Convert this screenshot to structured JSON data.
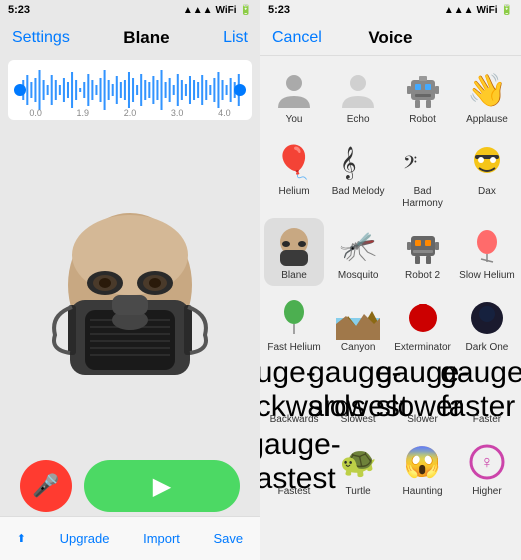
{
  "left": {
    "status": "5:23",
    "nav": {
      "back": "Settings",
      "title": "Blane",
      "right": "List"
    },
    "waveform": {
      "labels": [
        "0.0",
        "1.9",
        "2.0",
        "3.0",
        "4.0"
      ]
    },
    "controls": {
      "mic_aria": "Record",
      "play_aria": "Play"
    },
    "toolbar": {
      "share": "Share",
      "upgrade": "Upgrade",
      "import": "Import",
      "save": "Save"
    }
  },
  "right": {
    "status": "5:23",
    "nav": {
      "cancel": "Cancel",
      "title": "Voice"
    },
    "voices": [
      {
        "id": "you",
        "label": "You",
        "icon": "👤",
        "selected": false
      },
      {
        "id": "echo",
        "label": "Echo",
        "icon": "👤",
        "selected": false
      },
      {
        "id": "robot",
        "label": "Robot",
        "icon": "🤖",
        "selected": false
      },
      {
        "id": "applause",
        "label": "Applause",
        "icon": "👋",
        "selected": false
      },
      {
        "id": "helium",
        "label": "Helium",
        "icon": "🎈",
        "selected": false
      },
      {
        "id": "bad-melody",
        "label": "Bad Melody",
        "icon": "🎼",
        "selected": false
      },
      {
        "id": "bad-harmony",
        "label": "Bad Harmony",
        "icon": "🎼",
        "selected": false
      },
      {
        "id": "dax",
        "label": "Dax",
        "icon": "😎",
        "selected": false
      },
      {
        "id": "blane",
        "label": "Blane",
        "icon": "🎭",
        "selected": true
      },
      {
        "id": "mosquito",
        "label": "Mosquito",
        "icon": "🦟",
        "selected": false
      },
      {
        "id": "robot2",
        "label": "Robot 2",
        "icon": "🤖",
        "selected": false
      },
      {
        "id": "slow-helium",
        "label": "Slow Helium",
        "icon": "🎈",
        "selected": false
      },
      {
        "id": "fast-helium",
        "label": "Fast Helium",
        "icon": "🎈",
        "selected": false
      },
      {
        "id": "canyon",
        "label": "Canyon",
        "icon": "🏔️",
        "selected": false
      },
      {
        "id": "exterminator",
        "label": "Exterminator",
        "icon": "🔴",
        "selected": false
      },
      {
        "id": "dark-one",
        "label": "Dark One",
        "icon": "🖤",
        "selected": false
      },
      {
        "id": "backwards",
        "label": "Backwards",
        "icon": "gauge-backwards",
        "selected": false
      },
      {
        "id": "slowest",
        "label": "Slowest",
        "icon": "gauge-slowest",
        "selected": false
      },
      {
        "id": "slower",
        "label": "Slower",
        "icon": "gauge-slower",
        "selected": false
      },
      {
        "id": "faster",
        "label": "Faster",
        "icon": "gauge-faster",
        "selected": false
      },
      {
        "id": "fastest",
        "label": "Fastest",
        "icon": "gauge-fastest",
        "selected": false
      },
      {
        "id": "turtle",
        "label": "Turtle",
        "icon": "🐢",
        "selected": false
      },
      {
        "id": "haunting",
        "label": "Haunting",
        "icon": "😱",
        "selected": false
      },
      {
        "id": "higher",
        "label": "Higher",
        "icon": "♀",
        "selected": false
      }
    ]
  }
}
